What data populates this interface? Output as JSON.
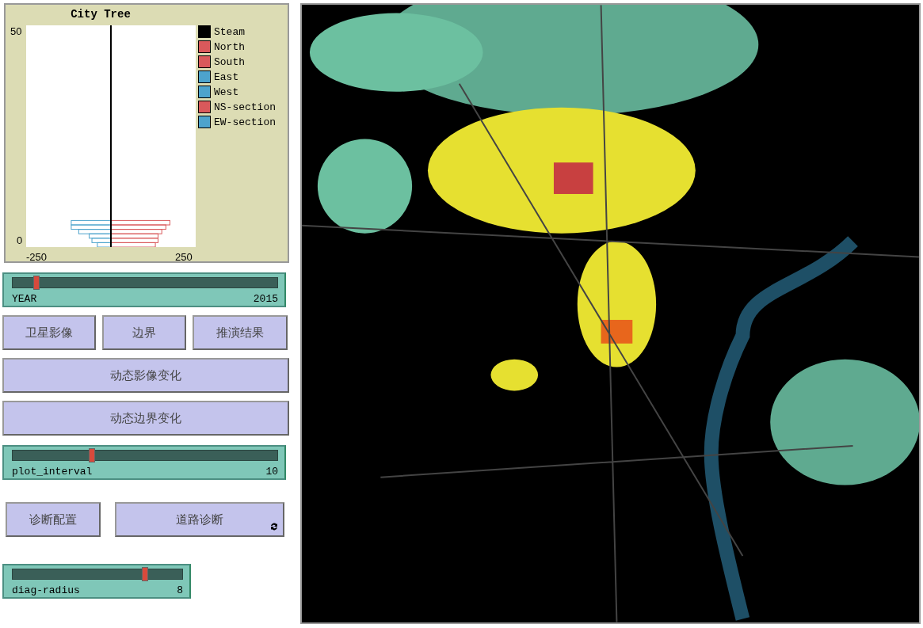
{
  "plot": {
    "title": "City Tree",
    "legend": [
      {
        "label": "Steam",
        "color": "#000000"
      },
      {
        "label": "North",
        "color": "#d9595b"
      },
      {
        "label": "South",
        "color": "#d9595b"
      },
      {
        "label": "East",
        "color": "#4da3cc"
      },
      {
        "label": "West",
        "color": "#4da3cc"
      },
      {
        "label": "NS-section",
        "color": "#d9595b"
      },
      {
        "label": "EW-section",
        "color": "#4da3cc"
      }
    ],
    "y_top_label": "50",
    "y_bottom_label": "0",
    "x_left_label": "-250",
    "x_right_label": "250"
  },
  "year_slider": {
    "label": "YEAR",
    "value": "2015",
    "level": 0.09
  },
  "buttons_row": [
    {
      "label": "卫星影像"
    },
    {
      "label": "边界"
    },
    {
      "label": "推演结果"
    }
  ],
  "wide_buttons": [
    {
      "label": "动态影像变化"
    },
    {
      "label": "动态边界变化"
    }
  ],
  "interval_slider": {
    "label": "plot_interval",
    "value": "10",
    "level": 0.3
  },
  "diag_buttons": [
    {
      "label": "诊断配置",
      "forever": false
    },
    {
      "label": "道路诊断",
      "forever": true
    }
  ],
  "radius_slider": {
    "label": "diag-radius",
    "value": "8",
    "level": 0.78
  }
}
